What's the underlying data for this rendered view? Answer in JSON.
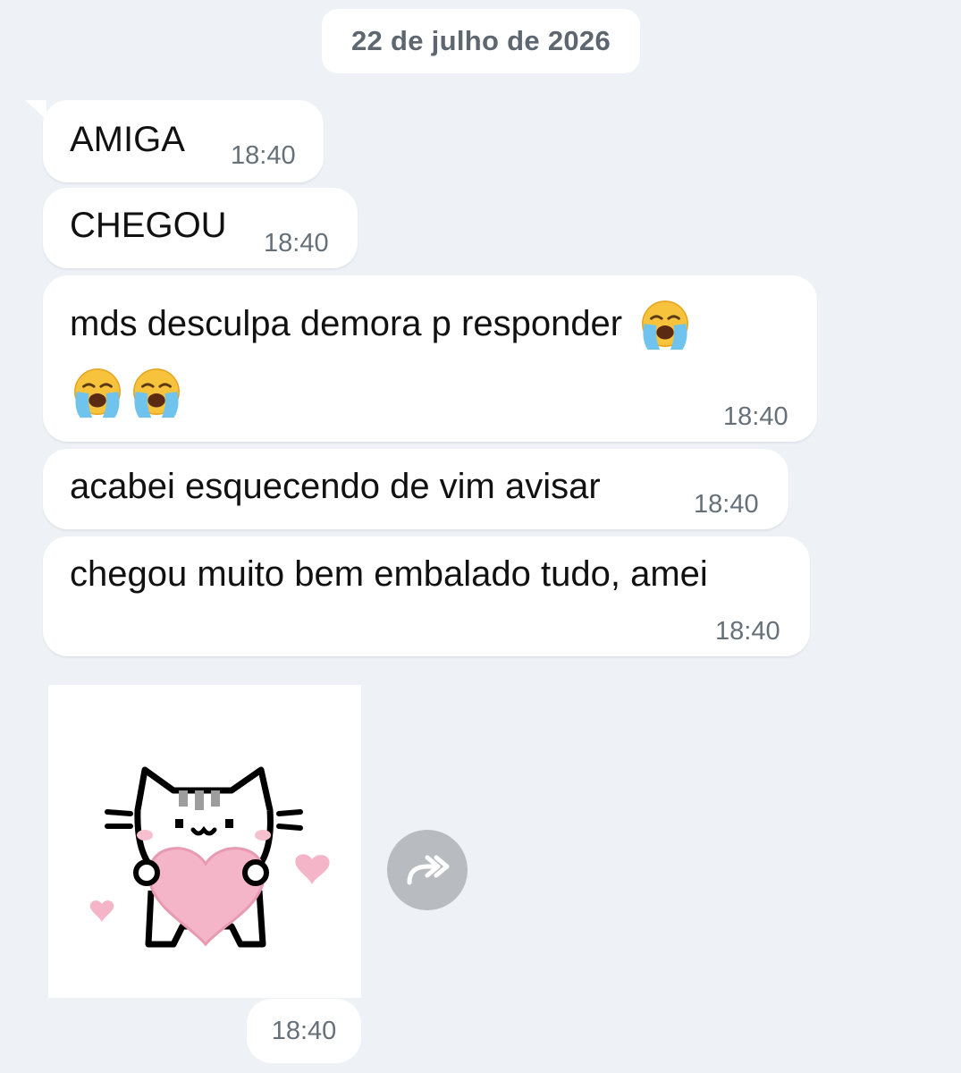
{
  "date_separator": "22 de julho de 2026",
  "messages": [
    {
      "text": "AMIGA",
      "time": "18:40"
    },
    {
      "text": "CHEGOU",
      "time": "18:40"
    },
    {
      "text": "mds desculpa demora p responder",
      "time": "18:40",
      "emojis": [
        "loudly-crying-face",
        "loudly-crying-face",
        "loudly-crying-face"
      ]
    },
    {
      "text": "acabei esquecendo de vim avisar",
      "time": "18:40"
    },
    {
      "text": "chegou muito bem embalado tudo, amei",
      "time": "18:40"
    }
  ],
  "sticker": {
    "icon": "cat-holding-heart-sticker",
    "time": "18:40"
  },
  "forward_icon": "forward-arrow-icon",
  "colors": {
    "background": "#eef2f7",
    "bubble": "#ffffff",
    "time_text": "#667079",
    "date_text": "#5e6670",
    "forward_button": "#b8bcc0",
    "heart_pink": "#f4b5c8"
  }
}
